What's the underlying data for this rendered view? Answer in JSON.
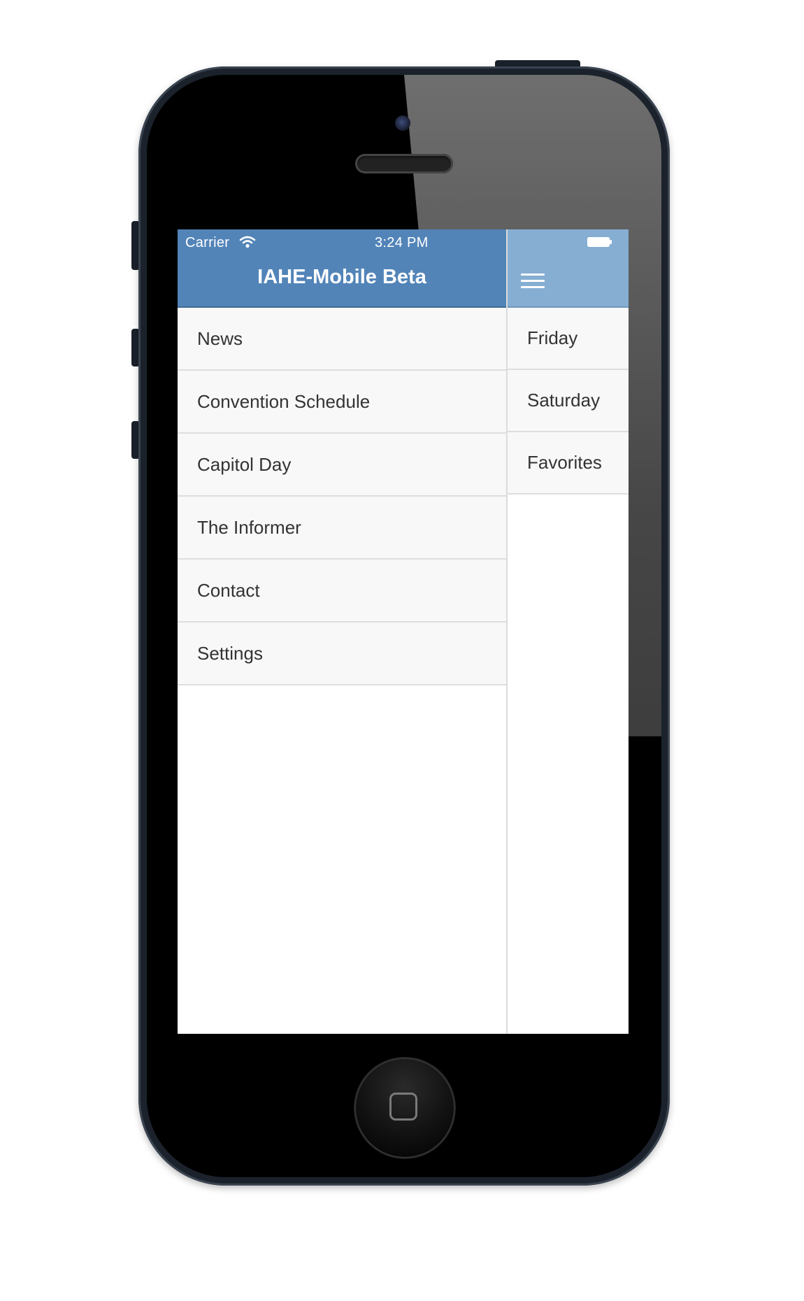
{
  "status_bar": {
    "carrier": "Carrier",
    "time": "3:24 PM"
  },
  "header": {
    "title": "IAHE-Mobile Beta",
    "menu_icon": "hamburger-icon"
  },
  "menu": {
    "items": [
      {
        "label": "News"
      },
      {
        "label": "Convention Schedule"
      },
      {
        "label": "Capitol Day"
      },
      {
        "label": "The Informer"
      },
      {
        "label": "Contact"
      },
      {
        "label": "Settings"
      }
    ]
  },
  "schedule": {
    "days": [
      {
        "label": "Friday"
      },
      {
        "label": "Saturday"
      },
      {
        "label": "Favorites"
      }
    ]
  },
  "colors": {
    "header_blue": "#5284b8",
    "header_blue_light": "#86aed3",
    "list_background": "#f8f8f8"
  }
}
